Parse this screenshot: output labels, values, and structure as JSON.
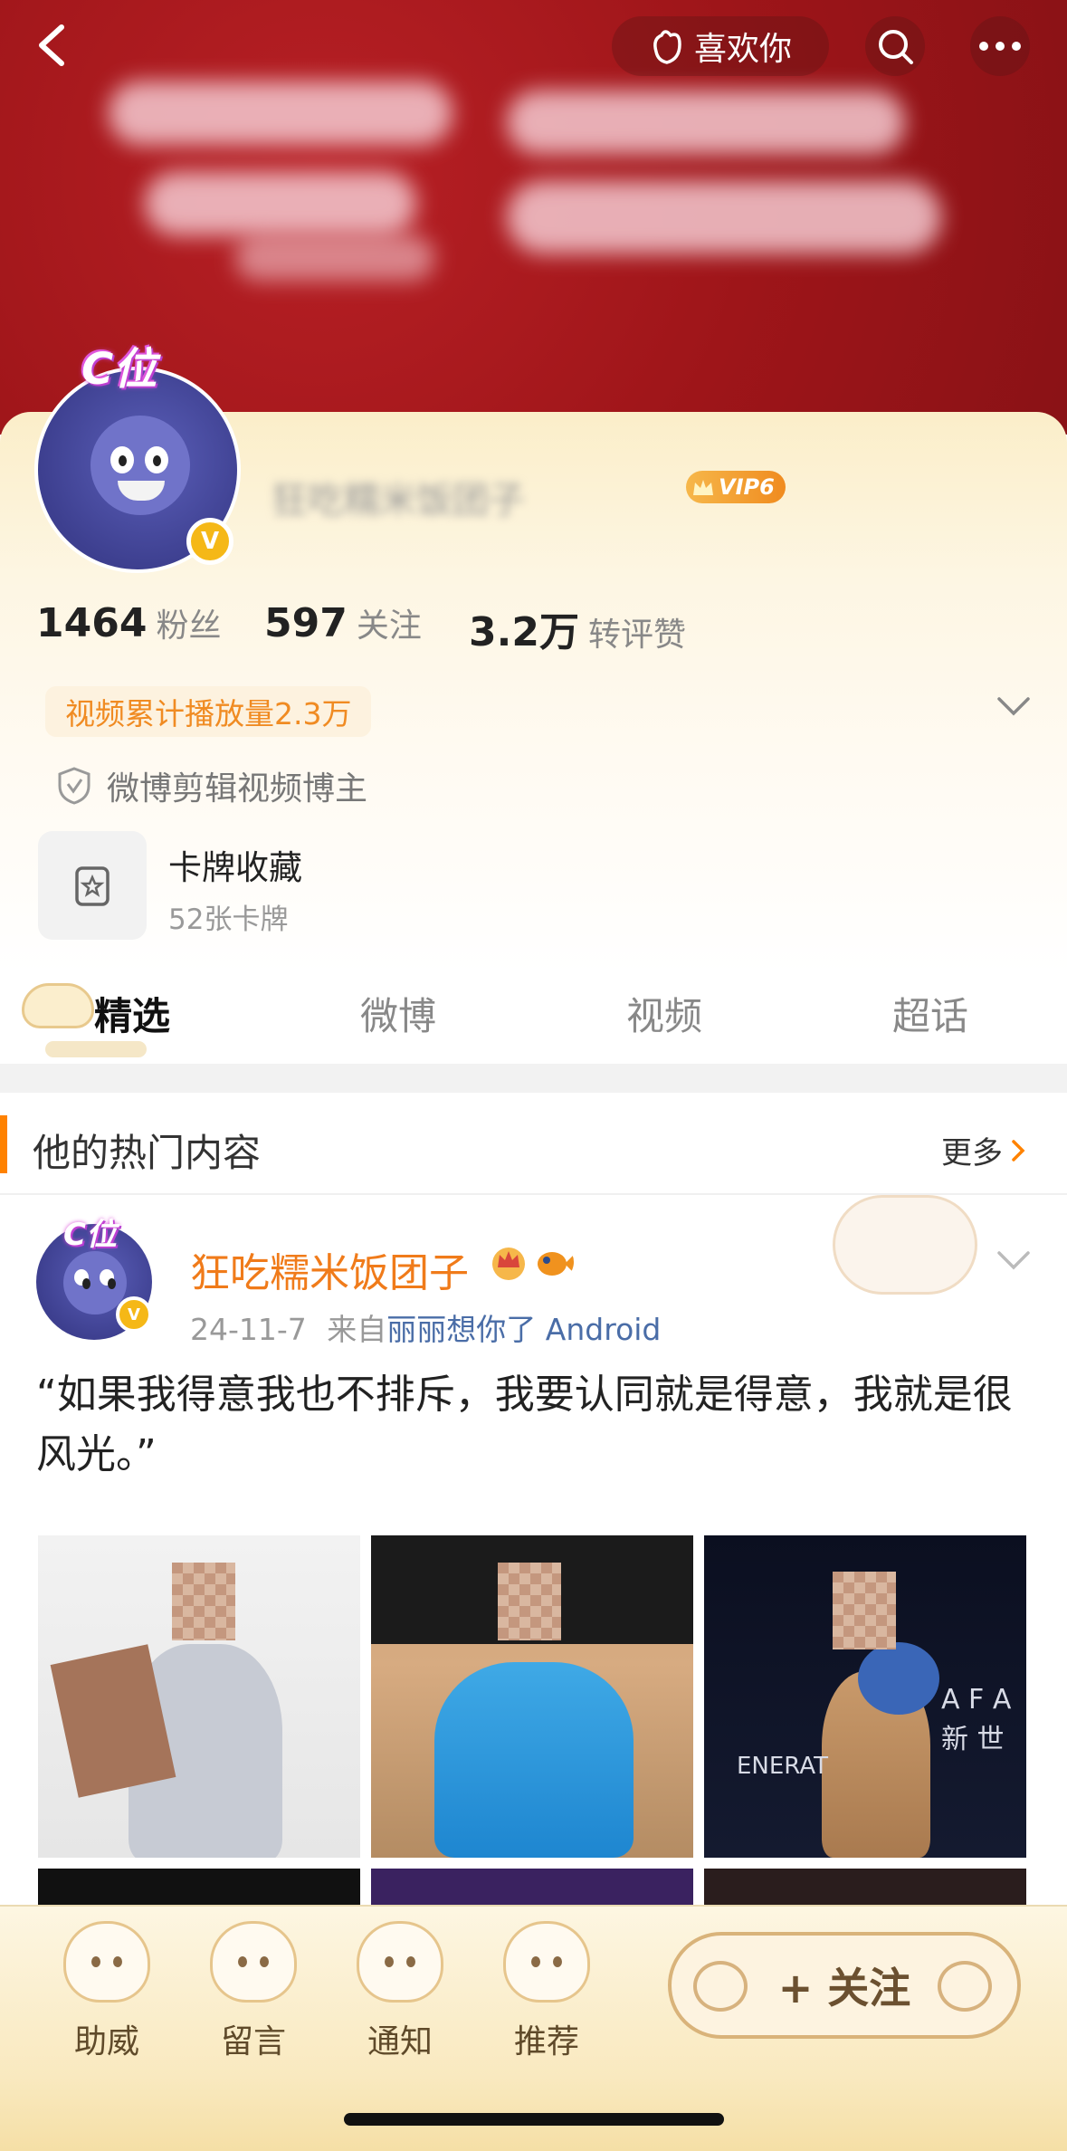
{
  "header": {
    "like_label": "喜欢你",
    "c_position": "C位",
    "username": "狂吃糯米饭团子",
    "vip": "VIP6"
  },
  "stats": [
    {
      "value": "1464",
      "label": "粉丝"
    },
    {
      "value": "597",
      "label": "关注"
    },
    {
      "value": "3.2万",
      "label": "转评赞"
    }
  ],
  "profile": {
    "play_count": "视频累计播放量2.3万",
    "blogger_tag": "微博剪辑视频博主",
    "cards_title": "卡牌收藏",
    "cards_sub": "52张卡牌"
  },
  "tabs": [
    {
      "label": "精选"
    },
    {
      "label": "微博"
    },
    {
      "label": "视频"
    },
    {
      "label": "超话"
    }
  ],
  "hot": {
    "title": "他的热门内容",
    "more": "更多"
  },
  "post": {
    "c_position": "C位",
    "name": "狂吃糯米饭团子",
    "date": "24-11-7",
    "source_prefix": "来自",
    "source": "丽丽想你了 Android",
    "text": "“如果我得意我也不排斥，我要认同就是得意，我就是很风光。”",
    "photo3_text": "A F A\n新 世",
    "photo3_text2": "ENERAT"
  },
  "bottom": {
    "items": [
      {
        "label": "助威"
      },
      {
        "label": "留言"
      },
      {
        "label": "通知"
      },
      {
        "label": "推荐"
      }
    ],
    "follow": "+ 关注"
  },
  "colors": {
    "accent_orange": "#ff8200",
    "username_orange": "#f07b1a",
    "link_blue": "#4a6da7",
    "verified_gold": "#f5b817"
  }
}
